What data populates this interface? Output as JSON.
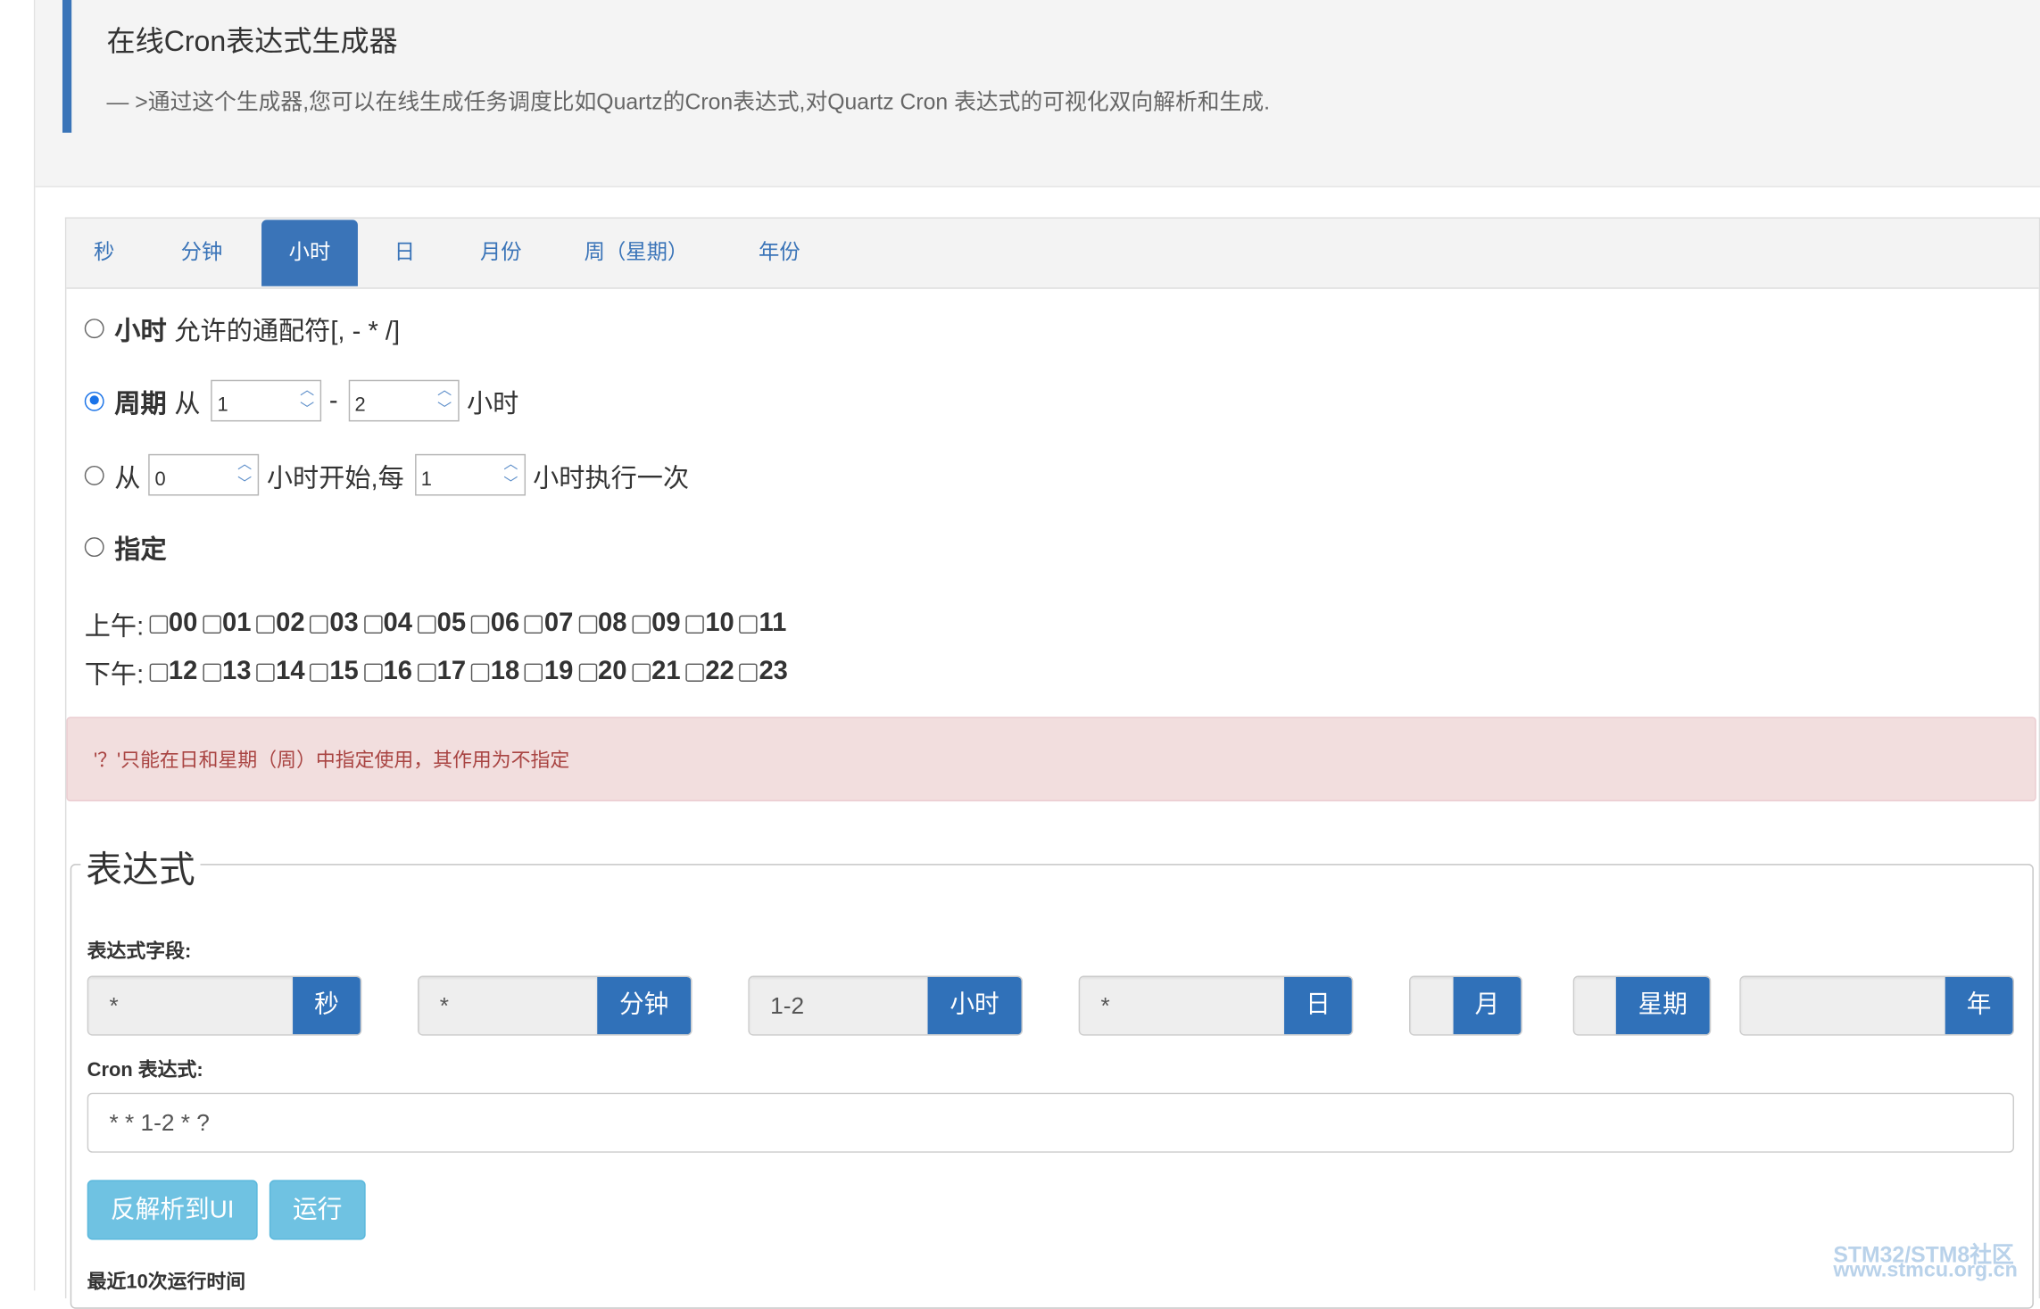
{
  "header": {
    "title": "在线Cron表达式生成器",
    "description": "— >通过这个生成器,您可以在线生成任务调度比如Quartz的Cron表达式,对Quartz Cron 表达式的可视化双向解析和生成."
  },
  "tabs": [
    "秒",
    "分钟",
    "小时",
    "日",
    "月份",
    "周（星期）",
    "年份"
  ],
  "active_tab": "小时",
  "options": {
    "every": {
      "label": "小时",
      "text": "允许的通配符[, - * /]",
      "checked": false
    },
    "cycle": {
      "label": "周期",
      "from": "从",
      "start": "1",
      "dash": "-",
      "end": "2",
      "unit": "小时",
      "checked": true
    },
    "interval": {
      "from": "从",
      "start": "0",
      "mid": "小时开始,每",
      "step": "1",
      "tail": "小时执行一次",
      "checked": false
    },
    "specify": {
      "label": "指定",
      "checked": false
    }
  },
  "hours": {
    "am_label": "上午:",
    "am": [
      "00",
      "01",
      "02",
      "03",
      "04",
      "05",
      "06",
      "07",
      "08",
      "09",
      "10",
      "11"
    ],
    "pm_label": "下午:",
    "pm": [
      "12",
      "13",
      "14",
      "15",
      "16",
      "17",
      "18",
      "19",
      "20",
      "21",
      "22",
      "23"
    ]
  },
  "alert": "'？'只能在日和星期（周）中指定使用，其作用为不指定",
  "expression": {
    "legend": "表达式",
    "fields_label": "表达式字段:",
    "fields": [
      {
        "value": "*",
        "unit": "秒"
      },
      {
        "value": "*",
        "unit": "分钟"
      },
      {
        "value": "1-2",
        "unit": "小时"
      },
      {
        "value": "*",
        "unit": "日"
      },
      {
        "value": "",
        "unit": "月"
      },
      {
        "value": "",
        "unit": "星期"
      },
      {
        "value": "",
        "unit": "年"
      }
    ],
    "cron_label": "Cron 表达式:",
    "cron_value": "* * 1-2 * ?",
    "reverse_button": "反解析到UI",
    "run_button": "运行",
    "recent_label": "最近10次运行时间"
  },
  "watermark": {
    "line1": "STM32/STM8社区",
    "line2": "www.stmcu.org.cn"
  },
  "colors": {
    "accent": "#3a74b8",
    "alert_bg": "#f2dede",
    "alert_text": "#a94442",
    "button": "#6fc2e2"
  }
}
